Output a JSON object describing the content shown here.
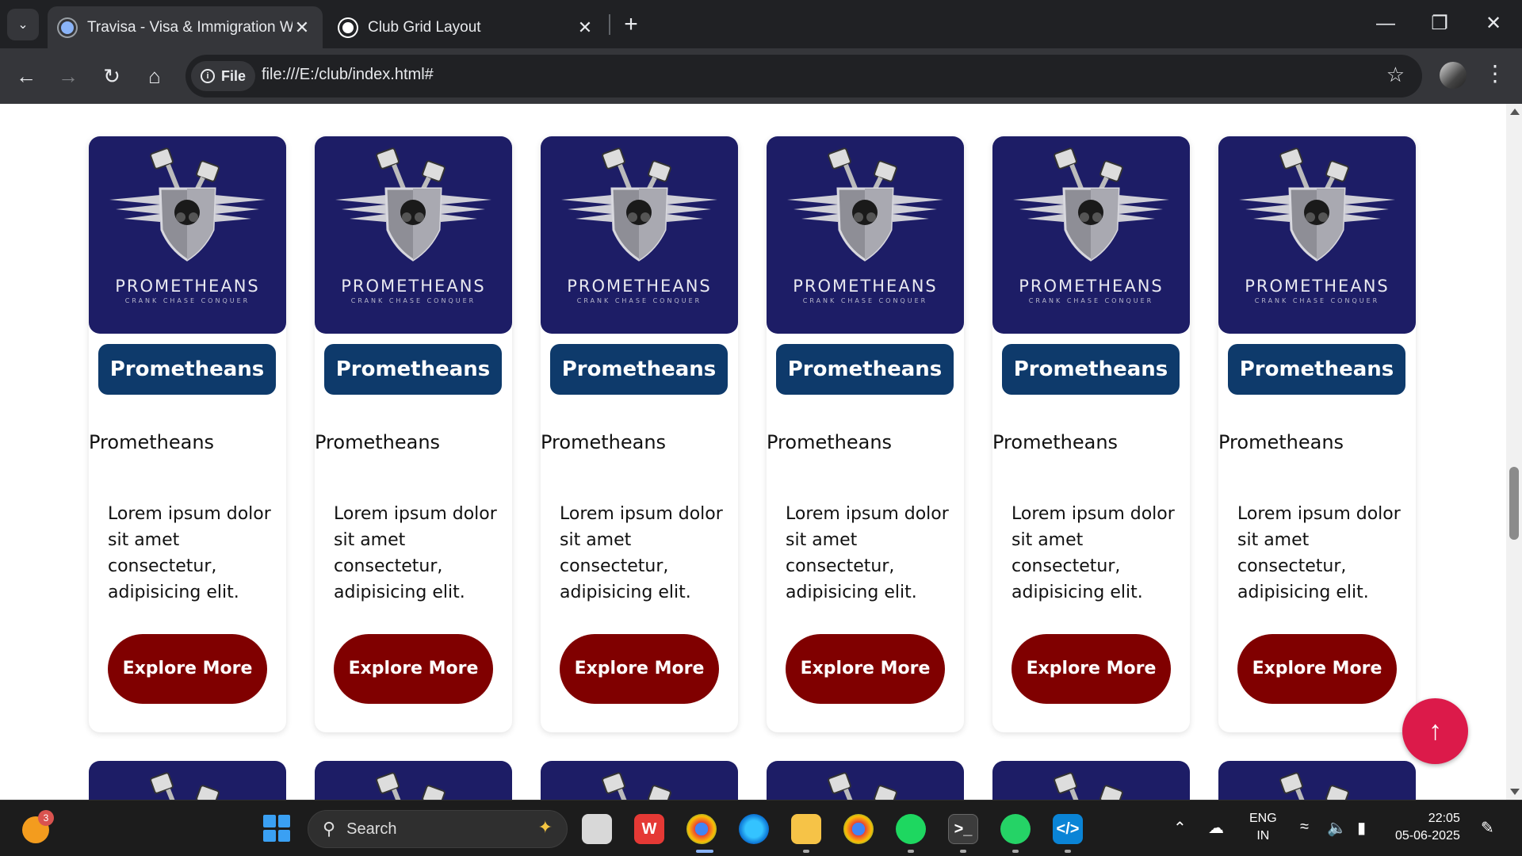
{
  "browser": {
    "tabs": [
      {
        "title": "Travisa - Visa & Immigration W",
        "active": true
      },
      {
        "title": "Club Grid Layout",
        "active": false
      }
    ],
    "site_chip": "File",
    "url": "file:///E:/club/index.html#"
  },
  "cards": [
    {
      "logo_text": "PROMETHEANS",
      "logo_tagline": "CRANK CHASE CONQUER",
      "badge": "Prometheans",
      "title": "Prometheans",
      "description": "Lorem ipsum dolor sit amet consectetur, adipisicing elit.",
      "button": "Explore More"
    },
    {
      "logo_text": "PROMETHEANS",
      "logo_tagline": "CRANK CHASE CONQUER",
      "badge": "Prometheans",
      "title": "Prometheans",
      "description": "Lorem ipsum dolor sit amet consectetur, adipisicing elit.",
      "button": "Explore More"
    },
    {
      "logo_text": "PROMETHEANS",
      "logo_tagline": "CRANK CHASE CONQUER",
      "badge": "Prometheans",
      "title": "Prometheans",
      "description": "Lorem ipsum dolor sit amet consectetur, adipisicing elit.",
      "button": "Explore More"
    },
    {
      "logo_text": "PROMETHEANS",
      "logo_tagline": "CRANK CHASE CONQUER",
      "badge": "Prometheans",
      "title": "Prometheans",
      "description": "Lorem ipsum dolor sit amet consectetur, adipisicing elit.",
      "button": "Explore More"
    },
    {
      "logo_text": "PROMETHEANS",
      "logo_tagline": "CRANK CHASE CONQUER",
      "badge": "Prometheans",
      "title": "Prometheans",
      "description": "Lorem ipsum dolor sit amet consectetur, adipisicing elit.",
      "button": "Explore More"
    },
    {
      "logo_text": "PROMETHEANS",
      "logo_tagline": "CRANK CHASE CONQUER",
      "badge": "Prometheans",
      "title": "Prometheans",
      "description": "Lorem ipsum dolor sit amet consectetur, adipisicing elit.",
      "button": "Explore More"
    }
  ],
  "scroll_top_icon": "arrow-up-icon",
  "colors": {
    "card_bg": "#1d1d66",
    "badge": "#0e3a6b",
    "button": "#800000",
    "fab": "#dc1a4a"
  },
  "taskbar": {
    "weather_badge": "3",
    "search_placeholder": "Search",
    "language": "ENG",
    "region": "IN",
    "time": "22:05",
    "date": "05-06-2025"
  }
}
